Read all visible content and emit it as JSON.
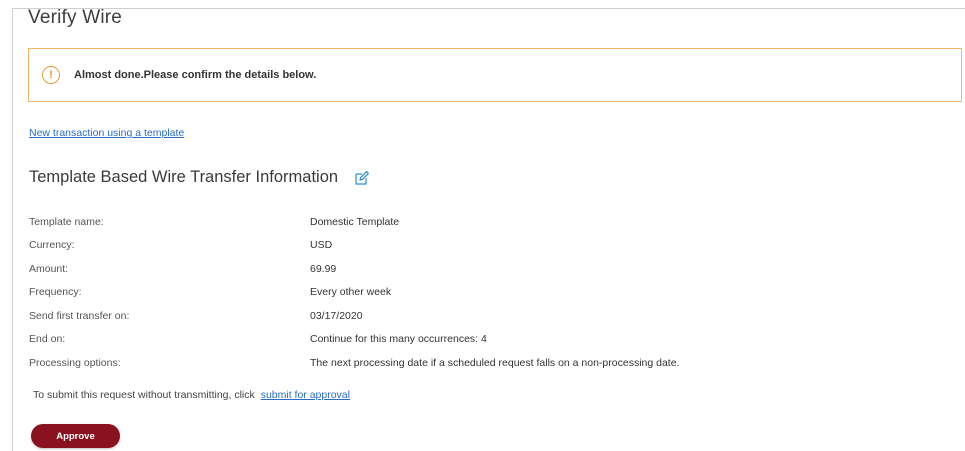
{
  "page": {
    "title": "Verify Wire"
  },
  "alert": {
    "icon": "warning-circle-icon",
    "text": "Almost done.Please confirm the details below.",
    "border_color": "#f2b46b",
    "icon_color": "#e69a3c"
  },
  "links": {
    "template_link": "New transaction using a template"
  },
  "section": {
    "title": "Template Based Wire Transfer Information",
    "edit_icon": "edit-pencil-icon"
  },
  "details": [
    {
      "label": "Template name:",
      "value": "Domestic Template"
    },
    {
      "label": "Currency:",
      "value": "USD"
    },
    {
      "label": "Amount:",
      "value": "69.99"
    },
    {
      "label": "Frequency:",
      "value": "Every other week"
    },
    {
      "label": "Send first transfer on:",
      "value": "03/17/2020"
    },
    {
      "label": "End on:",
      "value": "Continue for this many occurrences: 4"
    },
    {
      "label": "Processing options:",
      "value": "The next processing date if a scheduled request falls on a non-processing date."
    }
  ],
  "submit": {
    "note": "To submit this request without transmitting, click",
    "link": "submit for approval"
  },
  "actions": {
    "approve_label": "Approve",
    "approve_color": "#8a1220"
  },
  "colors": {
    "link": "#2b6cc4",
    "text": "#333333"
  }
}
